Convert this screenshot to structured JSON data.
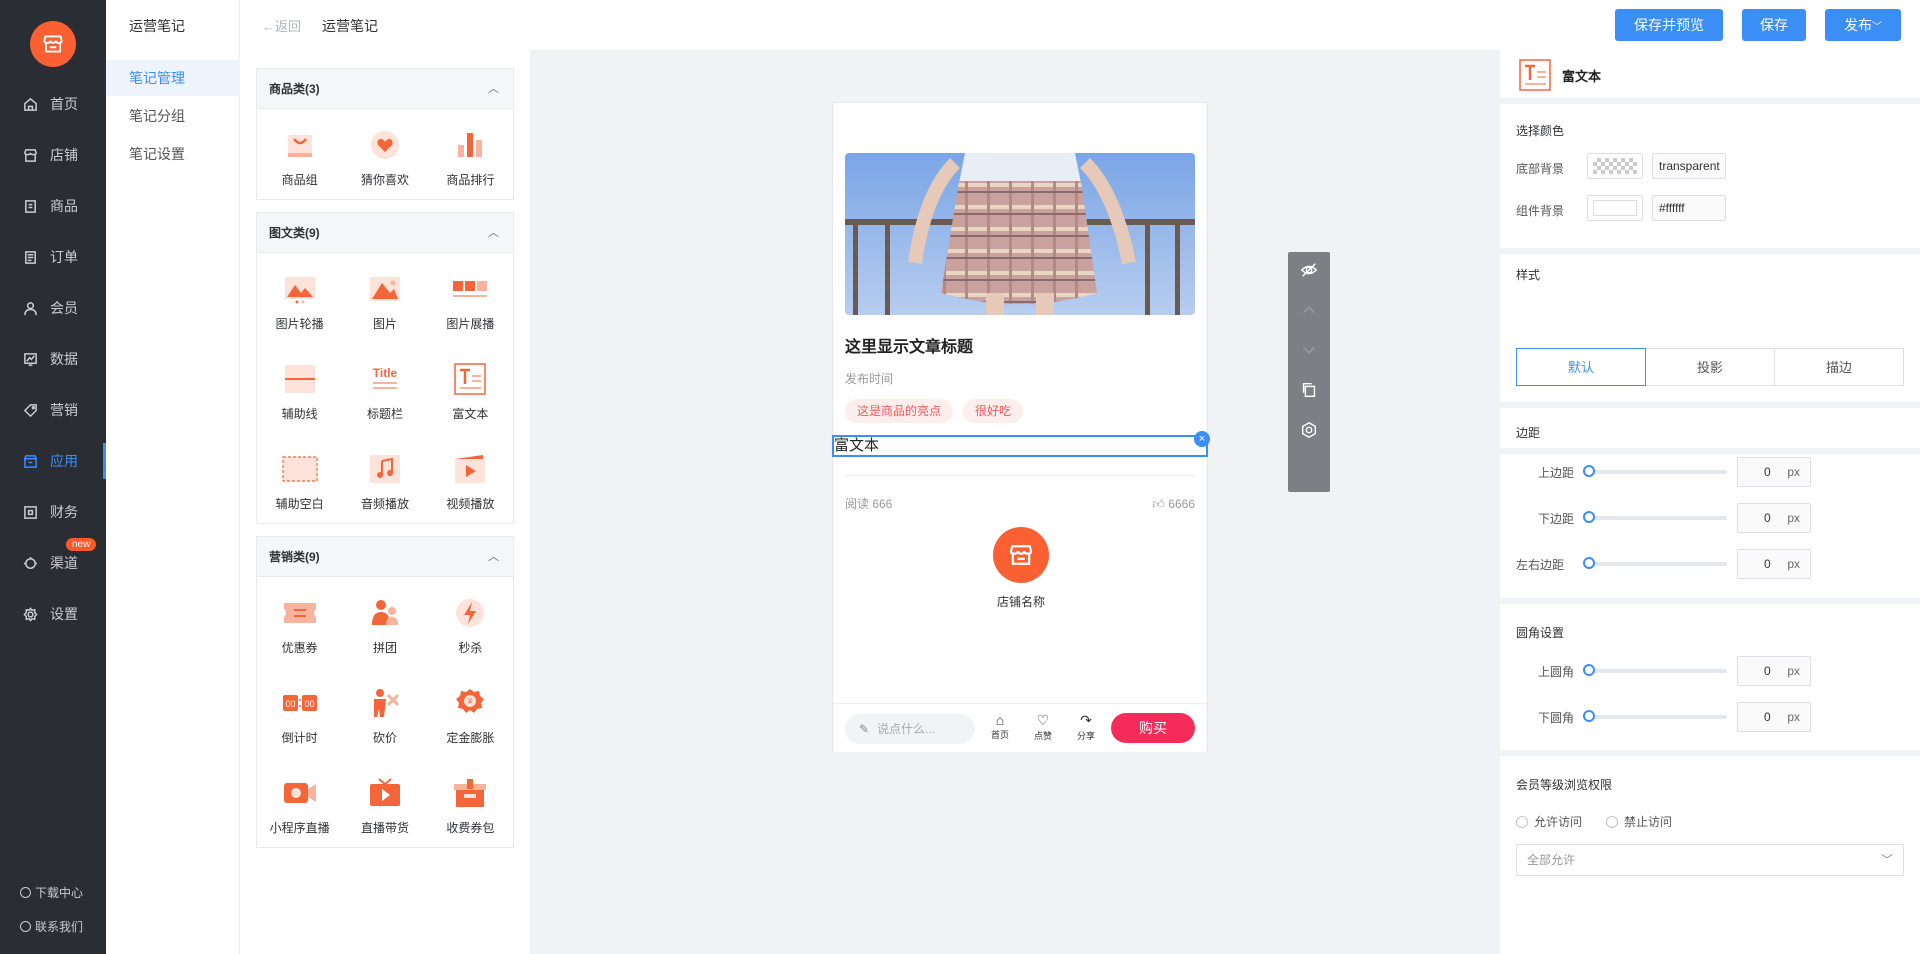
{
  "nav": {
    "items": [
      {
        "label": "首页",
        "icon": "home-icon"
      },
      {
        "label": "店铺",
        "icon": "store-icon"
      },
      {
        "label": "商品",
        "icon": "goods-icon"
      },
      {
        "label": "订单",
        "icon": "order-icon"
      },
      {
        "label": "会员",
        "icon": "member-icon"
      },
      {
        "label": "数据",
        "icon": "chart-icon"
      },
      {
        "label": "营销",
        "icon": "tag-icon"
      },
      {
        "label": "应用",
        "icon": "app-icon"
      },
      {
        "label": "财务",
        "icon": "finance-icon"
      },
      {
        "label": "渠道",
        "icon": "channel-icon"
      },
      {
        "label": "设置",
        "icon": "gear-icon"
      }
    ],
    "active": "应用",
    "channel_badge": "new",
    "download": "下载中心",
    "contact": "联系我们"
  },
  "subnav": {
    "title": "运营笔记",
    "items": [
      "笔记管理",
      "笔记分组",
      "笔记设置"
    ]
  },
  "header": {
    "back": "返回",
    "title": "运营笔记",
    "save_preview": "保存并预览",
    "save": "保存",
    "publish": "发布"
  },
  "components": {
    "groups": [
      {
        "title": "商品类(3)",
        "items": [
          "商品组",
          "猜你喜欢",
          "商品排行"
        ]
      },
      {
        "title": "图文类(9)",
        "items": [
          "图片轮播",
          "图片",
          "图片展播",
          "辅助线",
          "标题栏",
          "富文本",
          "辅助空白",
          "音频播放",
          "视频播放"
        ]
      },
      {
        "title": "营销类(9)",
        "items": [
          "优惠券",
          "拼团",
          "秒杀",
          "倒计时",
          "砍价",
          "定金膨胀",
          "小程序直播",
          "直播带货",
          "收费券包"
        ]
      }
    ],
    "title_icon_text": "Title"
  },
  "preview": {
    "article_title": "这里显示文章标题",
    "publish_time": "发布时间",
    "tags": [
      "这是商品的亮点",
      "很好吃"
    ],
    "rich_text": "富文本",
    "reads": "阅读 666",
    "likes": "6666",
    "shop_name": "店铺名称",
    "comment_placeholder": "说点什么...",
    "bottom_icons": [
      "首页",
      "点赞",
      "分享"
    ],
    "buy": "购买"
  },
  "props": {
    "component_name": "富文本",
    "color_section": "选择颜色",
    "bottom_bg_label": "底部背景",
    "bottom_bg_value": "transparent",
    "comp_bg_label": "组件背景",
    "comp_bg_value": "#ffffff",
    "style_section": "样式",
    "style_options": [
      "默认",
      "投影",
      "描边"
    ],
    "margin_section": "边距",
    "margins": [
      {
        "label": "上边距",
        "value": "0",
        "unit": "px"
      },
      {
        "label": "下边距",
        "value": "0",
        "unit": "px"
      },
      {
        "label": "左右边距",
        "value": "0",
        "unit": "px"
      }
    ],
    "radius_section": "圆角设置",
    "radius": [
      {
        "label": "上圆角",
        "value": "0",
        "unit": "px"
      },
      {
        "label": "下圆角",
        "value": "0",
        "unit": "px"
      }
    ],
    "member_section": "会员等级浏览权限",
    "allow": "允许访问",
    "deny": "禁止访问",
    "select_value": "全部允许"
  },
  "colors": {
    "accent": "#3a8ef6",
    "brand": "#fa6032",
    "nav_bg": "#2b2d35",
    "buy": "#f52c5a"
  }
}
